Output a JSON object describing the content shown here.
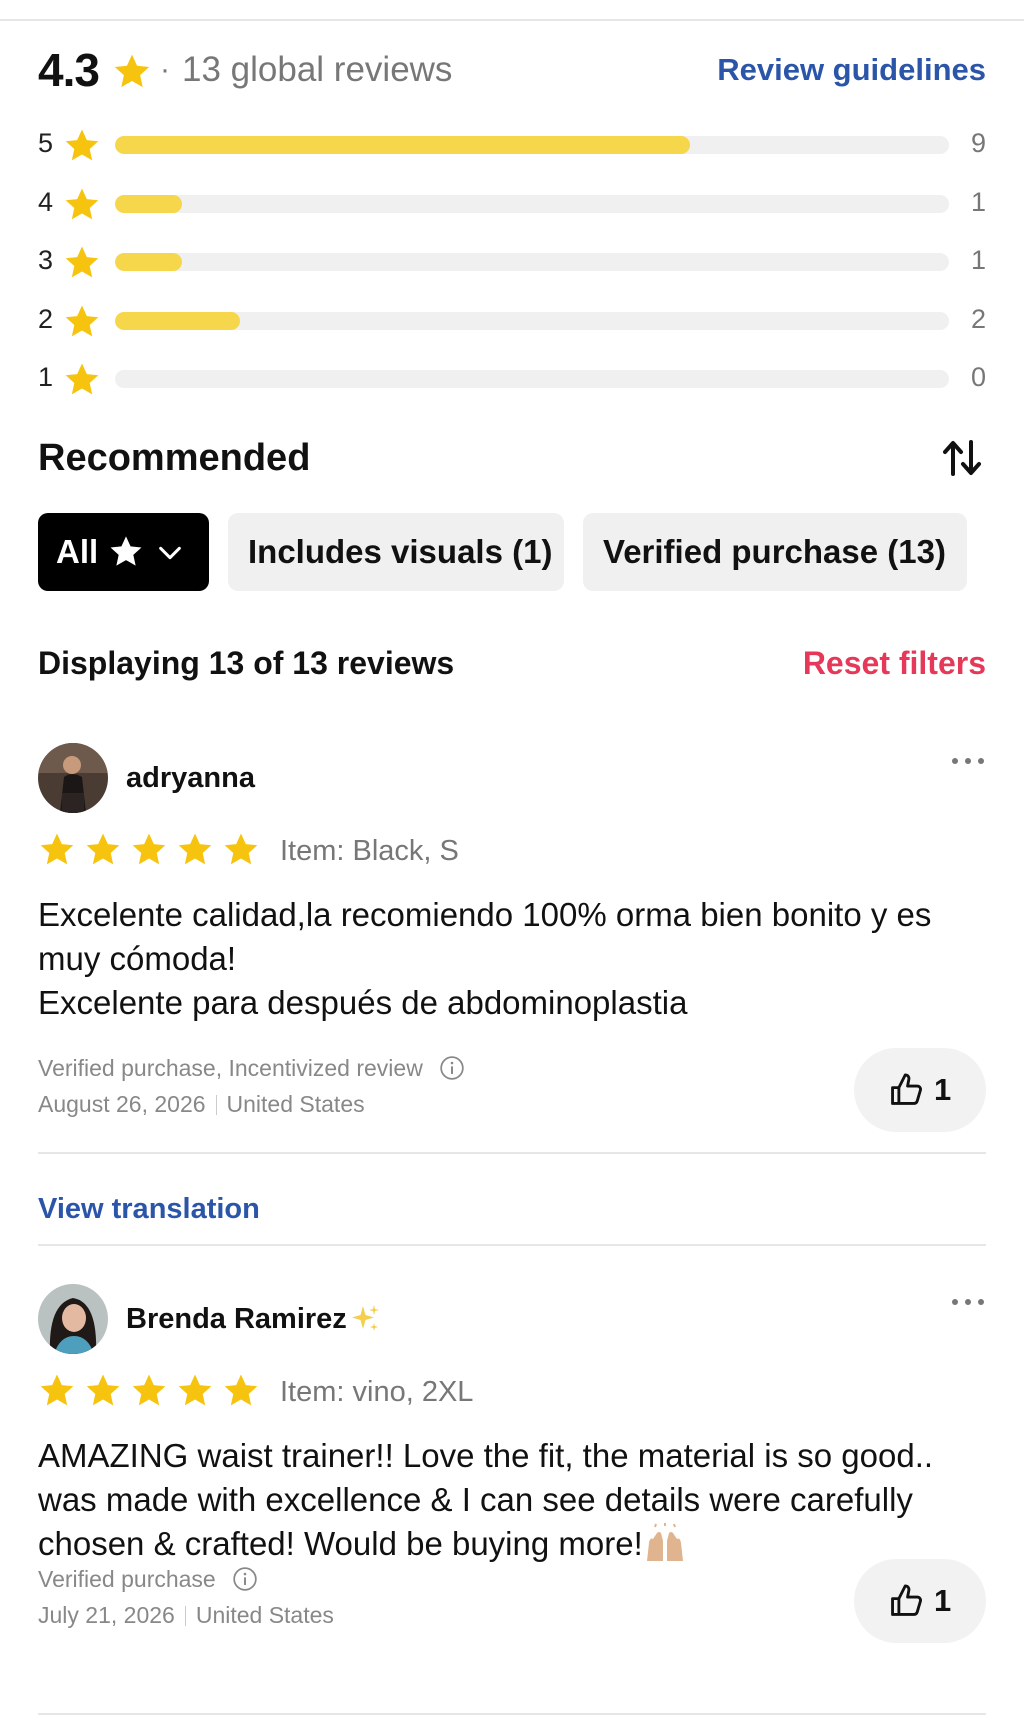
{
  "summary": {
    "average": "4.3",
    "dot": "·",
    "total_text": "13 global reviews",
    "guidelines_label": "Review guidelines"
  },
  "distribution": [
    {
      "stars": "5",
      "count": "9",
      "fraction": 0.69
    },
    {
      "stars": "4",
      "count": "1",
      "fraction": 0.08
    },
    {
      "stars": "3",
      "count": "1",
      "fraction": 0.08
    },
    {
      "stars": "2",
      "count": "2",
      "fraction": 0.15
    },
    {
      "stars": "1",
      "count": "0",
      "fraction": 0
    }
  ],
  "section": {
    "title": "Recommended",
    "sort_icon": "sort-arrows-icon"
  },
  "filters": {
    "all_label": "All",
    "visuals_label": "Includes visuals (1)",
    "verified_label": "Verified purchase (13)"
  },
  "results": {
    "displaying": "Displaying 13 of 13 reviews",
    "reset_label": "Reset filters"
  },
  "reviews": [
    {
      "author": "adryanna",
      "rating": 5,
      "item": "Item: Black, S",
      "body_lines": [
        "Excelente calidad,la recomiendo 100% orma bien bonito y es muy cómoda!",
        "Excelente para después de abdominoplastia"
      ],
      "badges": "Verified purchase, Incentivized review",
      "date": "August 26, 2026",
      "country": "United States",
      "helpful_count": "1",
      "view_translation": "View translation"
    },
    {
      "author": "Brenda Ramirez",
      "rating": 5,
      "item": "Item: vino, 2XL",
      "body_lines": [
        "AMAZING waist trainer!! Love the fit, the material is so good.. was made with excellence & I can see details were carefully chosen & crafted! Would be buying more!"
      ],
      "badges": "Verified purchase",
      "date": "July 21, 2026",
      "country": "United States",
      "helpful_count": "1"
    }
  ],
  "colors": {
    "star": "#f6c40f",
    "bar_fill": "#f6d64a",
    "bar_track": "#f0f0f0",
    "link_blue": "#2b55a8",
    "reset_red": "#e6395a"
  }
}
